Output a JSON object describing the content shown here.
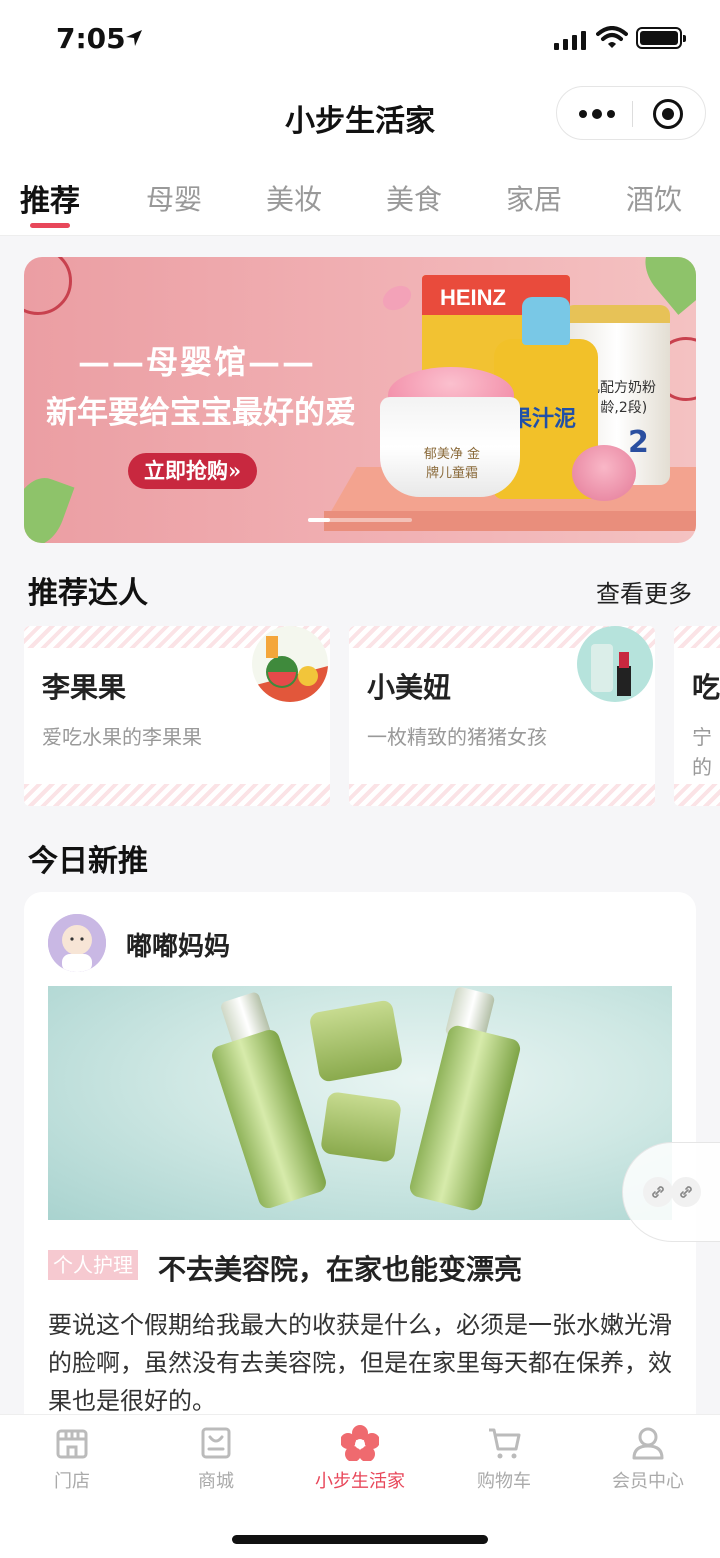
{
  "status_bar": {
    "time": "7:05"
  },
  "nav": {
    "title": "小步生活家"
  },
  "tabs": [
    {
      "label": "推荐",
      "active": true
    },
    {
      "label": "母婴"
    },
    {
      "label": "美妆"
    },
    {
      "label": "美食"
    },
    {
      "label": "家居"
    },
    {
      "label": "酒饮"
    }
  ],
  "banner": {
    "subtitle": "——母婴馆——",
    "headline": "新年要给宝宝最好的爱",
    "cta": "立即抢购»",
    "product_box": "HEINZ",
    "pouch_text": "果汁泥",
    "can_text": "婴儿配方奶粉 (2月龄,2段)",
    "can_number": "2",
    "cream_text": "郁美净 金牌儿童霜"
  },
  "creators_section": {
    "title": "推荐达人",
    "more": "查看更多"
  },
  "creators": [
    {
      "name": "李果果",
      "desc": "爱吃水果的李果果"
    },
    {
      "name": "小美妞",
      "desc": "一枚精致的猪猪女孩"
    },
    {
      "name": "吃",
      "desc": "宁的"
    }
  ],
  "feed_section": {
    "title": "今日新推"
  },
  "post": {
    "author": "嘟嘟妈妈",
    "tag": "个人护理",
    "title": "不去美容院，在家也能变漂亮",
    "body": "要说这个假期给我最大的收获是什么，必须是一张水嫩光滑的脸啊，虽然没有去美容院，但是在家里每天都在保养，效果也是很好的。"
  },
  "tab_bar": [
    {
      "label": "门店",
      "icon": "store-icon"
    },
    {
      "label": "商城",
      "icon": "bag-icon"
    },
    {
      "label": "小步生活家",
      "icon": "flower-icon",
      "active": true
    },
    {
      "label": "购物车",
      "icon": "cart-icon"
    },
    {
      "label": "会员中心",
      "icon": "user-icon"
    }
  ],
  "colors": {
    "accent": "#e8475a",
    "tag_bg": "#f6c9d0",
    "background": "#f6f6f8"
  }
}
